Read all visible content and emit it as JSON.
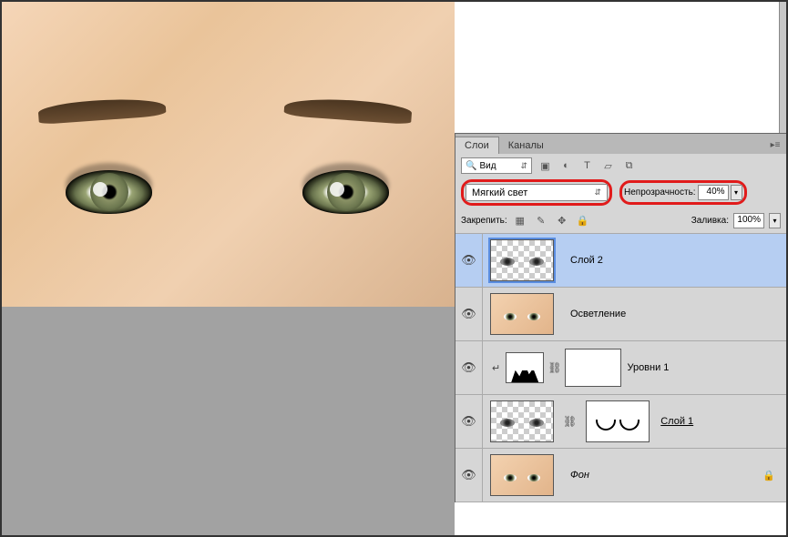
{
  "tabs": {
    "layers": "Слои",
    "channels": "Каналы"
  },
  "filter": {
    "label": "Вид"
  },
  "blend": {
    "mode": "Мягкий свет",
    "opacity_label": "Непрозрачность:",
    "opacity_value": "40%"
  },
  "lock": {
    "label": "Закрепить:",
    "fill_label": "Заливка:",
    "fill_value": "100%"
  },
  "layers": [
    {
      "name": "Слой 2"
    },
    {
      "name": "Осветление"
    },
    {
      "name": "Уровни 1"
    },
    {
      "name": "Слой 1"
    },
    {
      "name": "Фон"
    }
  ]
}
